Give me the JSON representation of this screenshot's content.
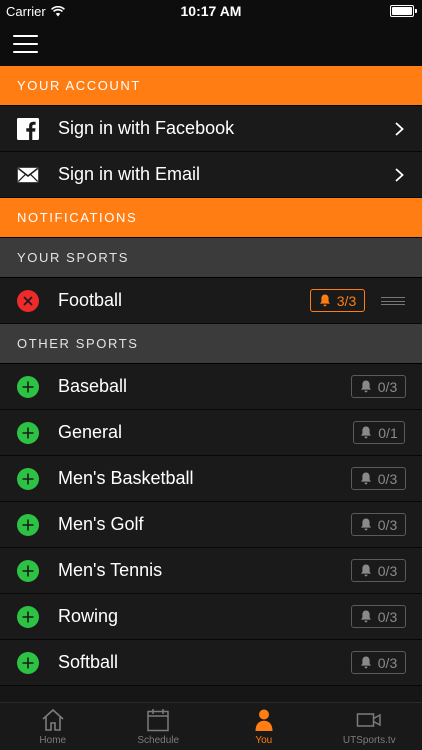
{
  "status_bar": {
    "carrier": "Carrier",
    "time": "10:17 AM"
  },
  "sections": {
    "account_title": "YOUR ACCOUNT",
    "account_items": [
      {
        "label": "Sign in with Facebook",
        "icon": "facebook-icon"
      },
      {
        "label": "Sign in with Email",
        "icon": "email-icon"
      }
    ],
    "notifications_title": "NOTIFICATIONS",
    "your_sports_title": "YOUR SPORTS",
    "your_sports": [
      {
        "label": "Football",
        "badge": "3/3",
        "action": "remove"
      }
    ],
    "other_sports_title": "OTHER SPORTS",
    "other_sports": [
      {
        "label": "Baseball",
        "badge": "0/3"
      },
      {
        "label": "General",
        "badge": "0/1"
      },
      {
        "label": "Men's Basketball",
        "badge": "0/3"
      },
      {
        "label": "Men's Golf",
        "badge": "0/3"
      },
      {
        "label": "Men's Tennis",
        "badge": "0/3"
      },
      {
        "label": "Rowing",
        "badge": "0/3"
      },
      {
        "label": "Softball",
        "badge": "0/3"
      }
    ]
  },
  "tabbar": {
    "tabs": [
      {
        "label": "Home",
        "icon": "home-icon"
      },
      {
        "label": "Schedule",
        "icon": "calendar-icon"
      },
      {
        "label": "You",
        "icon": "person-icon",
        "active": true
      },
      {
        "label": "UTSports.tv",
        "icon": "video-camera-icon"
      }
    ]
  },
  "colors": {
    "accent": "#ff7d12",
    "remove": "#ee2b2b",
    "add": "#2ec244",
    "background": "#1a1a1a"
  }
}
